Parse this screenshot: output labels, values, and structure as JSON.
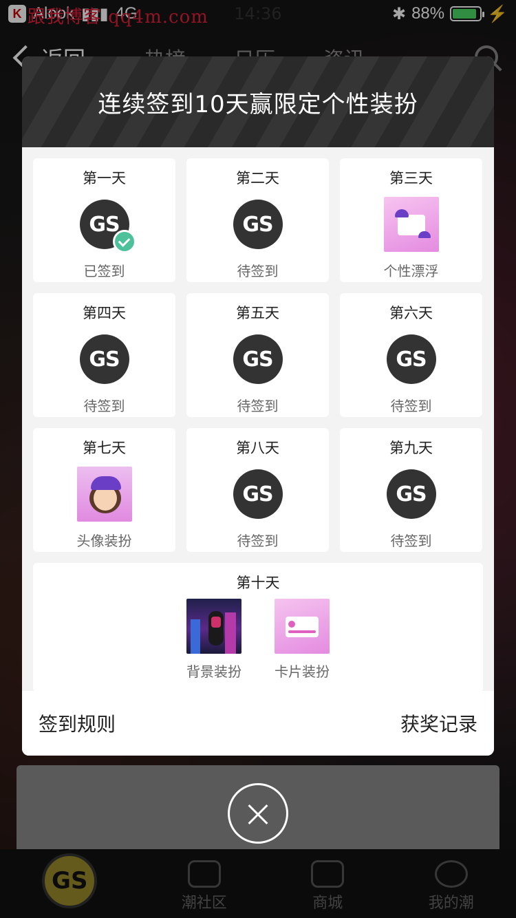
{
  "status_bar": {
    "carrier": "Alook",
    "network": "4G",
    "time": "14:36",
    "battery": "88%",
    "battery_level": 0.88,
    "watermark": "跟我博客 qq4m.com"
  },
  "nav": {
    "back_label": "返回",
    "tabs": [
      "热榜",
      "日历",
      "资讯"
    ]
  },
  "modal": {
    "title": "连续签到10天赢限定个性装扮",
    "days": [
      {
        "label": "第一天",
        "status": "已签到",
        "icon": "gs-coin-icon",
        "checked": true
      },
      {
        "label": "第二天",
        "status": "待签到",
        "icon": "gs-coin-icon"
      },
      {
        "label": "第三天",
        "status": "个性漂浮",
        "icon": "float-reward-image"
      },
      {
        "label": "第四天",
        "status": "待签到",
        "icon": "gs-coin-icon"
      },
      {
        "label": "第五天",
        "status": "待签到",
        "icon": "gs-coin-icon"
      },
      {
        "label": "第六天",
        "status": "待签到",
        "icon": "gs-coin-icon"
      },
      {
        "label": "第七天",
        "status": "头像装扮",
        "icon": "avatar-reward-image"
      },
      {
        "label": "第八天",
        "status": "待签到",
        "icon": "gs-coin-icon"
      },
      {
        "label": "第九天",
        "status": "待签到",
        "icon": "gs-coin-icon"
      }
    ],
    "coin_text": "GS",
    "day10": {
      "label": "第十天",
      "rewards": [
        {
          "label": "背景装扮",
          "icon": "background-reward-image"
        },
        {
          "label": "卡片装扮",
          "icon": "card-reward-image"
        }
      ]
    },
    "footer": {
      "rules": "签到规则",
      "records": "获奖记录"
    }
  },
  "bottom_tabs": {
    "home": "GS",
    "community": "潮社区",
    "shop": "商城",
    "mine": "我的潮"
  },
  "colors": {
    "check": "#4cc19a",
    "coin": "#333333",
    "header": "#2a2a2a",
    "battery": "#4cd964"
  }
}
